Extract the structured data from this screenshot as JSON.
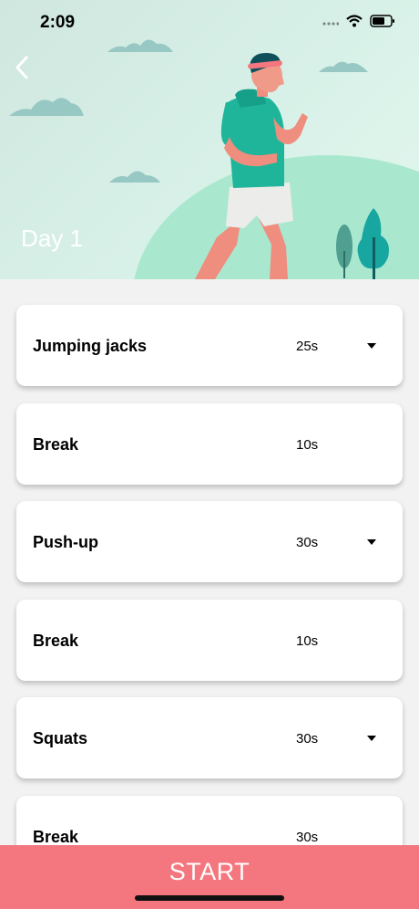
{
  "status_bar": {
    "time": "2:09",
    "icons": [
      "signal-icon",
      "wifi-icon",
      "battery-icon"
    ]
  },
  "header": {
    "back_icon": "chevron-left-icon",
    "title": "Day 1"
  },
  "exercises": [
    {
      "name": "Jumping jacks",
      "duration": "25s",
      "expandable": true
    },
    {
      "name": "Break",
      "duration": "10s",
      "expandable": false
    },
    {
      "name": "Push-up",
      "duration": "30s",
      "expandable": true
    },
    {
      "name": "Break",
      "duration": "10s",
      "expandable": false
    },
    {
      "name": "Squats",
      "duration": "30s",
      "expandable": true
    },
    {
      "name": "Break",
      "duration": "30s",
      "expandable": false
    }
  ],
  "footer": {
    "start_label": "START"
  },
  "colors": {
    "accent": "#f4767f",
    "hero_bg": "#d8f1e8",
    "shirt": "#1fb59a"
  }
}
